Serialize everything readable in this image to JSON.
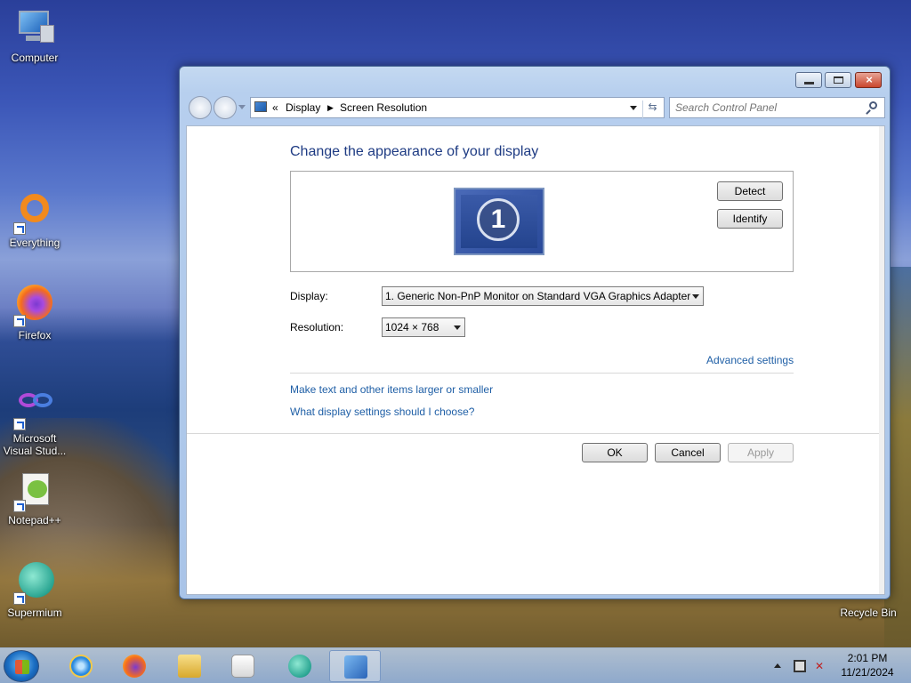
{
  "desktop": {
    "icons": [
      {
        "label": "Computer"
      },
      {
        "label": "Everything"
      },
      {
        "label": "Firefox"
      },
      {
        "label": "Microsoft Visual Stud..."
      },
      {
        "label": "Notepad++"
      },
      {
        "label": "Supermium"
      },
      {
        "label": "Recycle Bin"
      }
    ]
  },
  "window": {
    "address": {
      "prefix": "«",
      "crumbs": [
        "Display",
        "Screen Resolution"
      ]
    },
    "search_placeholder": "Search Control Panel",
    "title": "Change the appearance of your display",
    "monitor_number": "1",
    "detect_label": "Detect",
    "identify_label": "Identify",
    "display_label": "Display:",
    "display_value": "1. Generic Non-PnP Monitor on Standard VGA Graphics Adapter",
    "resolution_label": "Resolution:",
    "resolution_value": "1024 × 768",
    "advanced_link": "Advanced settings",
    "link_text_size": "Make text and other items larger or smaller",
    "link_which": "What display settings should I choose?",
    "ok_label": "OK",
    "cancel_label": "Cancel",
    "apply_label": "Apply"
  },
  "taskbar": {
    "time": "2:01 PM",
    "date": "11/21/2024"
  },
  "colors": {
    "accent": "#1e3b83",
    "link": "#1f5fa6"
  }
}
